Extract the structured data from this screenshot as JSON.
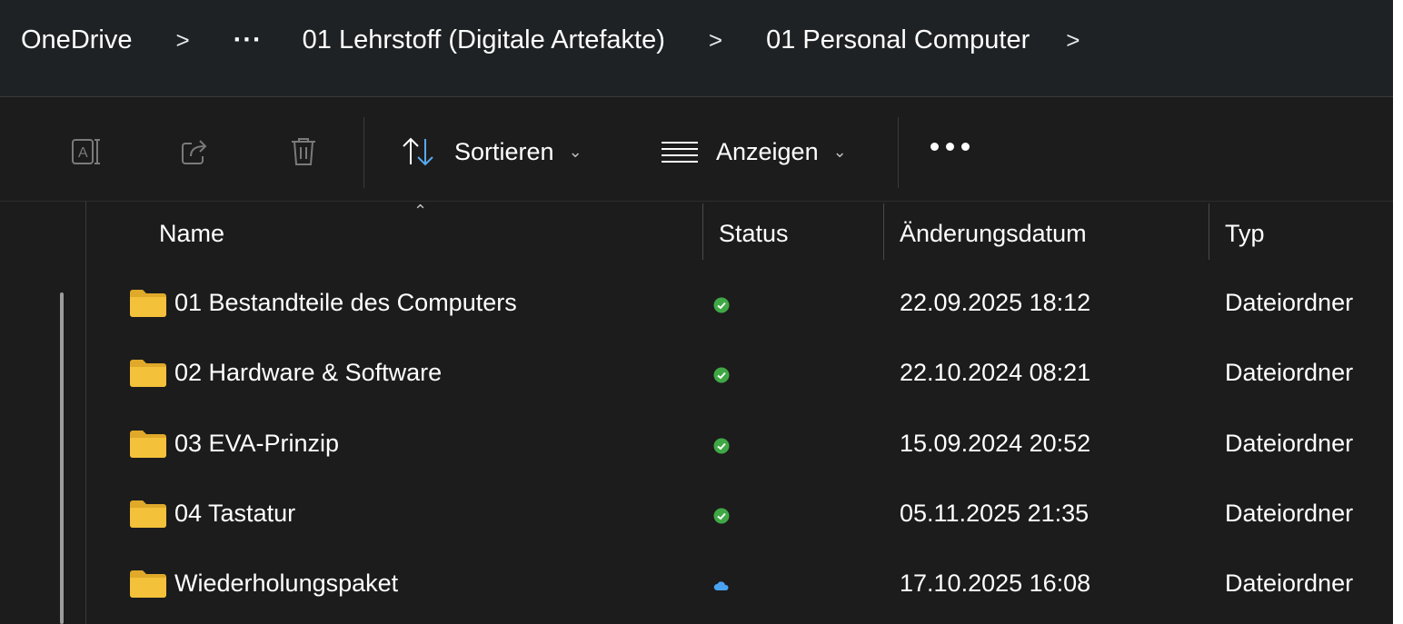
{
  "breadcrumb": {
    "root": "OneDrive",
    "overflow": "···",
    "level1": "01 Lehrstoff (Digitale Artefakte)",
    "level2": "01 Personal Computer",
    "separator": ">"
  },
  "toolbar": {
    "rename_icon": "rename-icon",
    "share_icon": "share-icon",
    "delete_icon": "trash-icon",
    "sort_label": "Sortieren",
    "view_label": "Anzeigen",
    "more_icon": "more-icon"
  },
  "columns": {
    "name": "Name",
    "status": "Status",
    "date": "Änderungsdatum",
    "type": "Typ"
  },
  "files": [
    {
      "name": "01 Bestandteile des Computers",
      "status": "synced",
      "date": "22.09.2025 18:12",
      "type": "Dateiordner"
    },
    {
      "name": "02 Hardware & Software",
      "status": "synced",
      "date": "22.10.2024 08:21",
      "type": "Dateiordner"
    },
    {
      "name": "03 EVA-Prinzip",
      "status": "synced",
      "date": "15.09.2024 20:52",
      "type": "Dateiordner"
    },
    {
      "name": "04 Tastatur",
      "status": "synced",
      "date": "05.11.2025 21:35",
      "type": "Dateiordner"
    },
    {
      "name": "Wiederholungspaket",
      "status": "cloud",
      "date": "17.10.2025 16:08",
      "type": "Dateiordner"
    }
  ],
  "colors": {
    "background": "#1c1c1c",
    "addressbar": "#1f2224",
    "folder": "#f3c13a",
    "synced": "#3fa845",
    "cloud": "#4aa3f0",
    "text": "#ffffff",
    "disabled_icon": "#7a7a7a"
  }
}
